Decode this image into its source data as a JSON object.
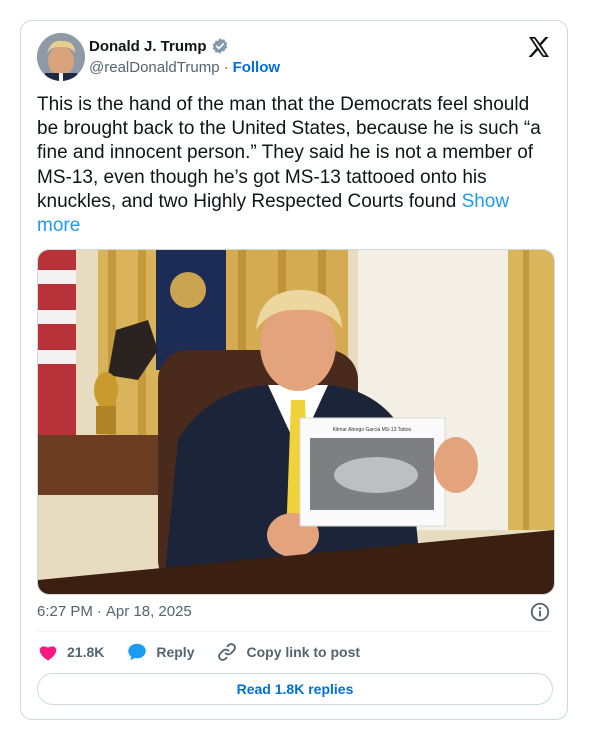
{
  "author": {
    "display_name": "Donald J. Trump",
    "handle": "@realDonaldTrump",
    "separator": "·",
    "follow_label": "Follow",
    "verified_color": "#829aab"
  },
  "tweet": {
    "text": "This is the hand of the man that the Democrats feel should be brought back to the United States, because he is such “a fine and innocent person.” They said he is not a member of MS-13, even though he’s got MS-13 tattooed onto his knuckles, and two Highly Respected Courts found ",
    "show_more": "Show more",
    "photo_paper_caption": "Kilmar Abrego Garcia MS-13 Tattoo"
  },
  "meta": {
    "time": "6:27 PM",
    "separator": "·",
    "date": "Apr 18, 2025"
  },
  "actions": {
    "likes_count": "21.8K",
    "reply_label": "Reply",
    "copy_link_label": "Copy link to post"
  },
  "read_replies_label": "Read 1.8K replies",
  "colors": {
    "like": "#f91880",
    "reply": "#1d9bf0",
    "link": "#006fd6",
    "secondary_text": "#536471",
    "border": "#cfd9de"
  },
  "icons": {
    "logo": "x-logo-icon",
    "verified": "verified-badge-icon",
    "info": "info-icon",
    "like": "heart-icon",
    "reply": "speech-bubble-icon",
    "copy_link": "link-icon"
  }
}
